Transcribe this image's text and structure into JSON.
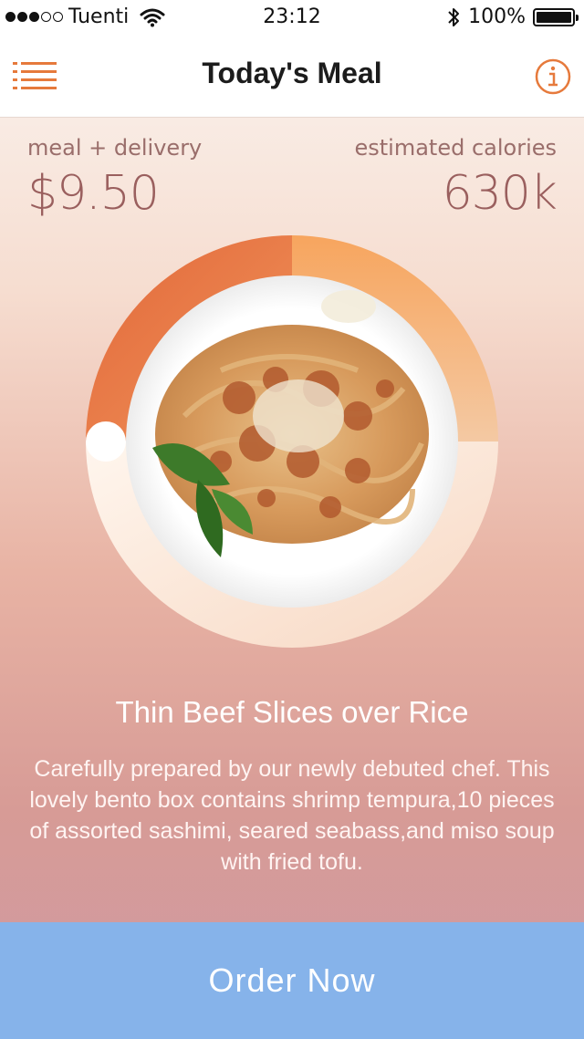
{
  "status_bar": {
    "carrier": "Tuenti",
    "time": "23:12",
    "battery_percent": "100%",
    "signal_bars_filled": 3,
    "signal_bars_total": 5,
    "battery_level": 1.0
  },
  "nav": {
    "title": "Today's Meal",
    "left_icon": "menu-list-icon",
    "right_icon": "info-icon",
    "accent_color": "#e67a3c"
  },
  "stats": {
    "price_label": "meal + delivery",
    "price_value": "$9.50",
    "calories_label": "estimated calories",
    "calories_value": "630k"
  },
  "meal": {
    "image_icon": "pasta-plate-image",
    "ring_colors": [
      "#e6743e",
      "#f6a861",
      "#fff1e6"
    ],
    "title": "Thin Beef Slices over Rice",
    "description": "Carefully prepared by our newly debuted chef. This lovely bento box contains shrimp tempura,10 pieces of assorted sashimi, seared seabass,and miso soup with fried tofu."
  },
  "order_button": {
    "label": "Order Now",
    "color": "#86b3ea"
  }
}
